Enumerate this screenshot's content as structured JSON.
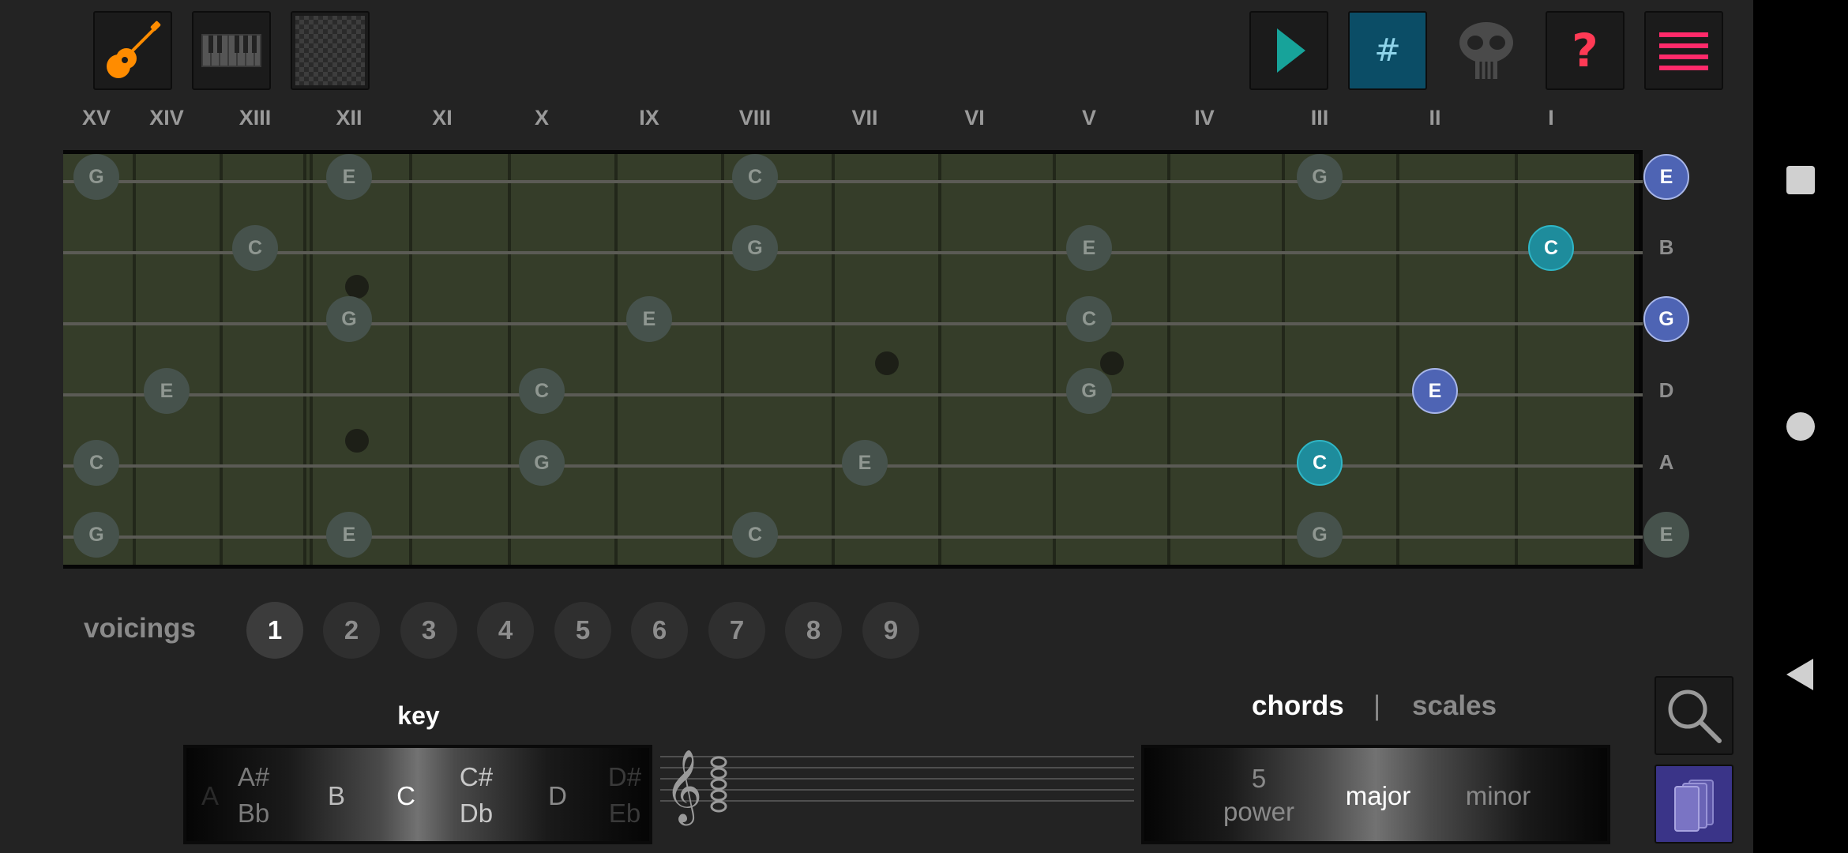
{
  "toolbar": {
    "left_tools": [
      {
        "icon": "guitar-icon",
        "active": true
      },
      {
        "icon": "piano-icon",
        "active": false
      },
      {
        "icon": "checkerboard-icon",
        "active": false
      }
    ],
    "right_tools": [
      {
        "icon": "play-icon"
      },
      {
        "icon": "sharp-icon",
        "label": "#",
        "active": true
      },
      {
        "icon": "skull-icon"
      },
      {
        "icon": "help-icon",
        "label": "?"
      },
      {
        "icon": "menu-icon"
      }
    ]
  },
  "fret_numerals": [
    "XV",
    "XIV",
    "XIII",
    "XII",
    "XI",
    "X",
    "IX",
    "VIII",
    "VII",
    "VI",
    "V",
    "IV",
    "III",
    "II",
    "I"
  ],
  "strings": [
    "E",
    "B",
    "G",
    "D",
    "A",
    "E"
  ],
  "notes": {
    "string_1": [
      "G",
      "E",
      "C",
      "G",
      "E"
    ],
    "string_2": [
      "C",
      "G",
      "E",
      "C"
    ],
    "string_3": [
      "G",
      "E",
      "C",
      "G"
    ],
    "string_4": [
      "E",
      "C",
      "G",
      "E"
    ],
    "string_5": [
      "C",
      "G",
      "E",
      "C"
    ],
    "string_6": [
      "G",
      "E",
      "C",
      "G",
      "E"
    ]
  },
  "voicings": {
    "label": "voicings",
    "options": [
      "1",
      "2",
      "3",
      "4",
      "5",
      "6",
      "7",
      "8",
      "9"
    ],
    "selected": "1"
  },
  "key": {
    "title": "key",
    "items": [
      "A",
      "A#",
      "Bb",
      "B",
      "C",
      "C#",
      "Db",
      "D",
      "D#",
      "Eb"
    ],
    "selected": "C"
  },
  "mode_tabs": {
    "chords": "chords",
    "divider": "|",
    "scales": "scales",
    "active": "chords"
  },
  "chord_types": {
    "items": [
      "5",
      "power",
      "major",
      "minor"
    ],
    "selected": "major"
  },
  "side_buttons": [
    {
      "icon": "search-icon"
    },
    {
      "icon": "library-icon"
    }
  ],
  "colors": {
    "accent_guitar": "#ff8c00",
    "play": "#17a39a",
    "sharp_bg": "#0b4d66",
    "help": "#ff3a55",
    "menu": "#ff2a6a",
    "root_note": "#1e8c9c",
    "third_note": "#4e64b4",
    "fretboard": "#353d29"
  },
  "system_nav": [
    {
      "icon": "recents-icon"
    },
    {
      "icon": "home-icon"
    },
    {
      "icon": "back-icon"
    }
  ]
}
